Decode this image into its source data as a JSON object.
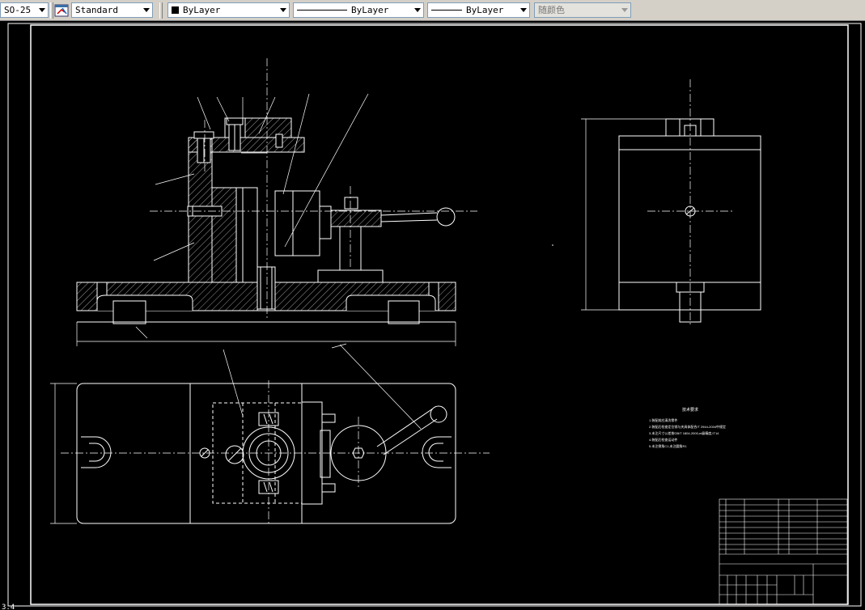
{
  "toolbar": {
    "dimstyle": "SO-25",
    "textstyle": "Standard",
    "layer_color": "ByLayer",
    "linetype": "ByLayer",
    "lineweight": "ByLayer",
    "plot_style": "随颜色",
    "icons": [
      "dimstyle-manager-icon"
    ]
  },
  "drawing": {
    "tech_requirements_title": "技术要求",
    "tech_requirements": [
      "1.装配前应清洗零件",
      "2.装配后检查定位销与夹具体配合/T 2944-2004中规定",
      "3.未注尺寸公差按GB/T 1804-2000,m级精度,IT14",
      "4.装配后检查运动件",
      "5.未注倒角C1,未注圆角R1"
    ],
    "cursor_label": "3.4"
  },
  "colors": {
    "background": "#000000",
    "lines": "#ffffff",
    "toolbar": "#d4d0c8"
  }
}
